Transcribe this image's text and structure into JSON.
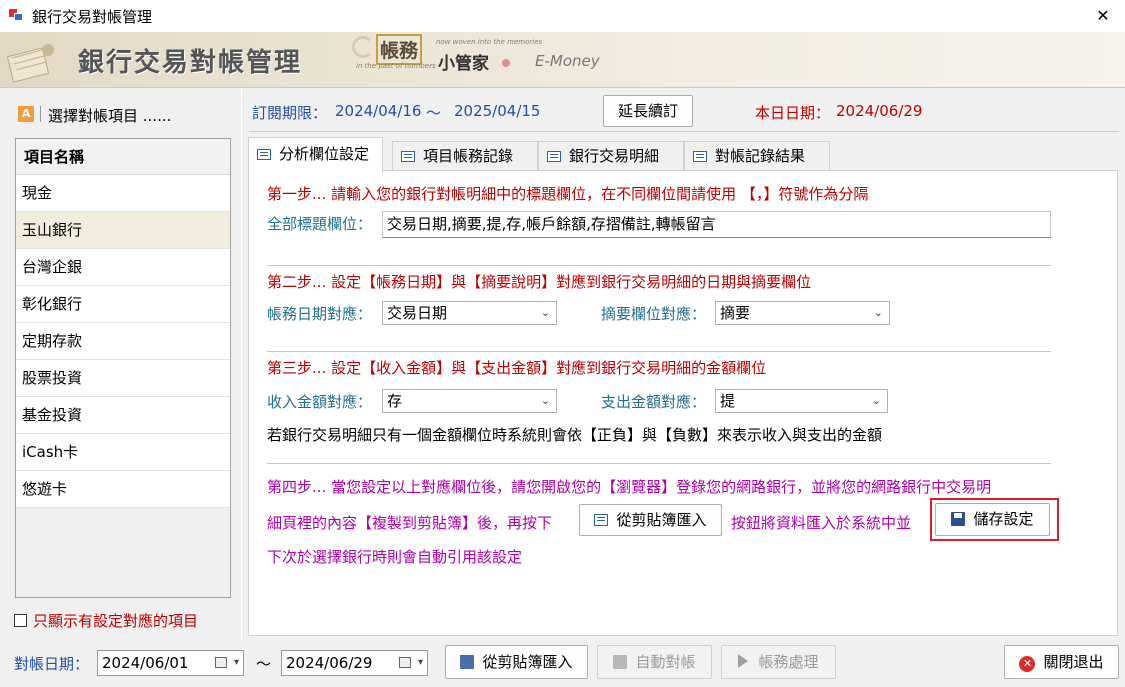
{
  "window": {
    "title": "銀行交易對帳管理",
    "close_glyph": "✕"
  },
  "banner": {
    "title": "銀行交易對帳管理",
    "brand_line1": "帳務",
    "brand_line2": "小管家",
    "brand_en": "E-Money",
    "tagline1": "now woven into the memories",
    "tagline2": "in the past of numbers"
  },
  "sidebar": {
    "header": "選擇對帳項目 ......",
    "icon_letter": "A",
    "list_header": "項目名稱",
    "items": [
      {
        "label": "現金",
        "selected": false
      },
      {
        "label": "玉山銀行",
        "selected": true
      },
      {
        "label": "台灣企銀",
        "selected": false
      },
      {
        "label": "彰化銀行",
        "selected": false
      },
      {
        "label": "定期存款",
        "selected": false
      },
      {
        "label": "股票投資",
        "selected": false
      },
      {
        "label": "基金投資",
        "selected": false
      },
      {
        "label": "iCash卡",
        "selected": false
      },
      {
        "label": "悠遊卡",
        "selected": false
      }
    ],
    "only_configured_label": "只顯示有設定對應的項目"
  },
  "subscription": {
    "label": "訂閱期限：",
    "start": "2024/04/16",
    "tilde": "～",
    "end": "2025/04/15",
    "renew_button": "延長續訂",
    "today_label": "本日日期：",
    "today": "2024/06/29"
  },
  "tabs": [
    {
      "label": "分析欄位設定",
      "active": true
    },
    {
      "label": "項目帳務記錄",
      "active": false
    },
    {
      "label": "銀行交易明細",
      "active": false
    },
    {
      "label": "對帳記錄結果",
      "active": false
    }
  ],
  "step1": {
    "text": "第一步... 請輸入您的銀行對帳明細中的標題欄位，在不同欄位間請使用 【，】符號作為分隔",
    "label": "全部標題欄位：",
    "value": "交易日期,摘要,提,存,帳戶餘額,存摺備註,轉帳留言"
  },
  "step2": {
    "text": "第二步... 設定【帳務日期】與【摘要說明】對應到銀行交易明細的日期與摘要欄位",
    "date_label": "帳務日期對應：",
    "date_value": "交易日期",
    "summary_label": "摘要欄位對應：",
    "summary_value": "摘要"
  },
  "step3": {
    "text": "第三步... 設定【收入金額】與【支出金額】對應到銀行交易明細的金額欄位",
    "income_label": "收入金額對應：",
    "income_value": "存",
    "expense_label": "支出金額對應：",
    "expense_value": "提",
    "note": "若銀行交易明細只有一個金額欄位時系統則會依【正負】與【負數】來表示收入與支出的金額"
  },
  "step4": {
    "line1": "第四步... 當您設定以上對應欄位後，請您開啟您的【瀏覽器】登錄您的網路銀行，並將您的網路銀行中交易明",
    "line2a": "細頁裡的內容【複製到剪貼簿】後，再按下",
    "import_button": "從剪貼簿匯入",
    "line2b": "按鈕將資料匯入於系統中並",
    "save_button": "儲存設定",
    "line3": "下次於選擇銀行時則會自動引用該設定"
  },
  "bottom": {
    "date_label": "對帳日期：",
    "from": "2024/06/01",
    "tilde": "～",
    "to": "2024/06/29",
    "import_button": "從剪貼簿匯入",
    "auto_button": "自動對帳",
    "process_button": "帳務處理",
    "close_button": "關閉退出",
    "close_glyph": "✕",
    "chevron": "▾",
    "combo_chevron": "⌄"
  }
}
